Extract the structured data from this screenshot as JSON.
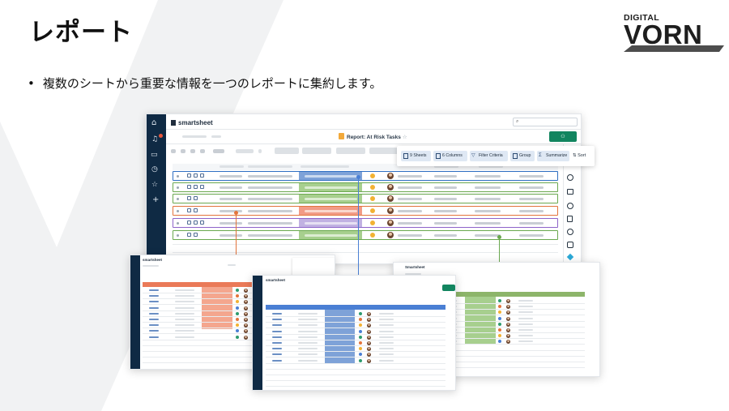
{
  "slide": {
    "title": "レポート",
    "bullet": "複数のシートから重要な情報を一つのレポートに集約します。"
  },
  "logo": {
    "top_text": "DIGITAL",
    "main_text": "VORN"
  },
  "report_window": {
    "brand": "smartsheet",
    "title": "Report: At Risk Tasks",
    "share_icon": "share-icon",
    "toolbar": {
      "sheets": "9 Sheets",
      "columns": "6 Columns",
      "filter": "Filter Criteria",
      "group": "Group",
      "summarize": "Summarize",
      "sort": "Sort"
    },
    "row_colors": [
      "#2f6fc2",
      "#6aa84f",
      "#6aa84f",
      "#e3743c",
      "#8e63c9",
      "#6aa84f"
    ]
  },
  "sheets": {
    "left": {
      "brand": "smartsheet",
      "accent": "#ea7a58"
    },
    "center": {
      "brand": "smartsheet",
      "accent": "#4a7fd4"
    },
    "right": {
      "brand": "Smartsheet",
      "accent": "#8db56a"
    }
  },
  "colors": {
    "nav_rail": "#0f2a44",
    "primary_green": "#12855f",
    "highlight_blue": "#7ea2d8",
    "highlight_green": "#a7cf8e",
    "highlight_red": "#f29b86"
  }
}
